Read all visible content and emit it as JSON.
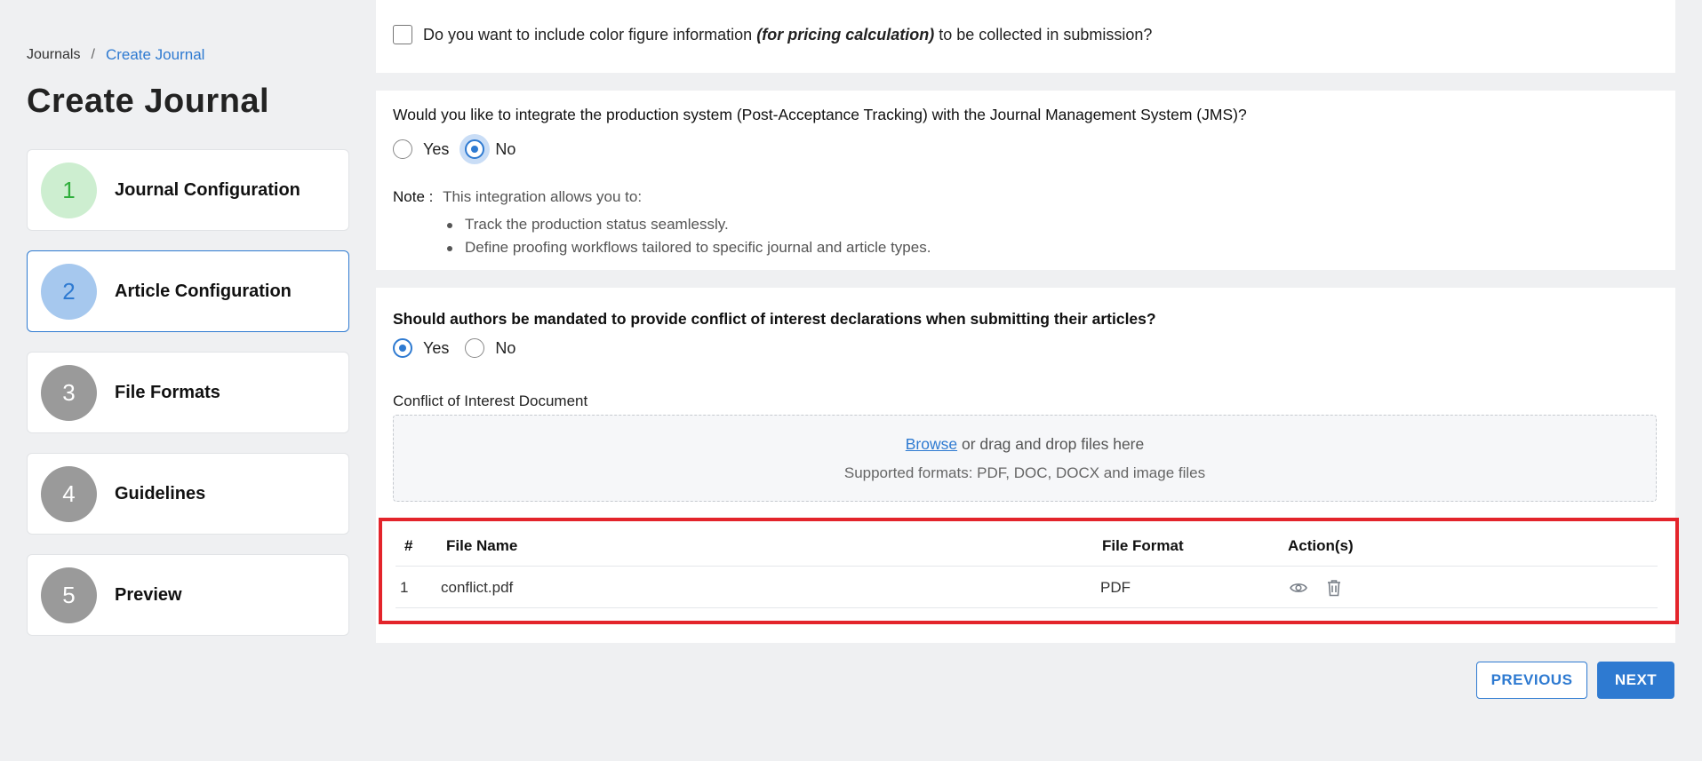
{
  "breadcrumb": {
    "root": "Journals",
    "separator": "/",
    "current": "Create Journal"
  },
  "page": {
    "title": "Create Journal"
  },
  "steps": [
    {
      "number": "1",
      "label": "Journal Configuration",
      "state": "completed"
    },
    {
      "number": "2",
      "label": "Article Configuration",
      "state": "active"
    },
    {
      "number": "3",
      "label": "File Formats",
      "state": "pending"
    },
    {
      "number": "4",
      "label": "Guidelines",
      "state": "pending"
    },
    {
      "number": "5",
      "label": "Preview",
      "state": "pending"
    }
  ],
  "color_figure": {
    "text_before": "Do you want to include color figure information",
    "text_emphasis": "(for pricing calculation)",
    "text_after": "to be collected in submission?",
    "checked": false
  },
  "integration": {
    "question": "Would you like to integrate the production system (Post-Acceptance Tracking) with the Journal Management System (JMS)?",
    "options": [
      "Yes",
      "No"
    ],
    "selected": "No",
    "note_label": "Note :",
    "note_intro": "This integration allows you to:",
    "note_items": [
      "Track the production status seamlessly.",
      "Define proofing workflows tailored to specific journal and article types."
    ]
  },
  "conflict": {
    "question": "Should authors be mandated to provide conflict of interest declarations when submitting their articles?",
    "options": [
      "Yes",
      "No"
    ],
    "selected": "Yes",
    "document_label": "Conflict of Interest Document",
    "dropzone": {
      "browse": "Browse",
      "rest": "or drag and drop files here",
      "formats": "Supported formats: PDF, DOC, DOCX and image files"
    },
    "table": {
      "headers": [
        "#",
        "File Name",
        "File Format",
        "Action(s)"
      ],
      "rows": [
        {
          "index": "1",
          "file_name": "conflict.pdf",
          "format": "PDF"
        }
      ]
    }
  },
  "footer": {
    "previous": "PREVIOUS",
    "next": "NEXT"
  },
  "colors": {
    "accent": "#2e7ad1",
    "highlight": "#e3242b",
    "completed": "#2fae3c"
  },
  "icons": {
    "view": "eye-icon",
    "delete": "trash-icon"
  }
}
